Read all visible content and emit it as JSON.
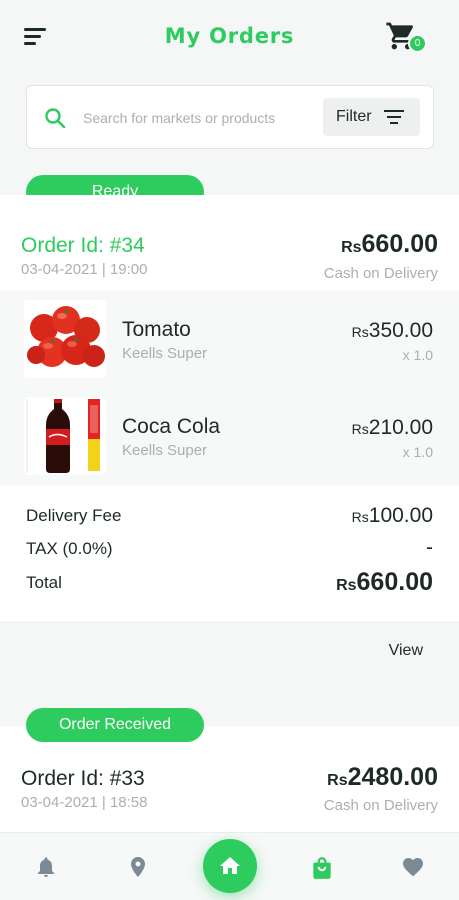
{
  "header": {
    "title": "My Orders",
    "cart_count": "0"
  },
  "search": {
    "placeholder": "Search for markets or products",
    "filter_label": "Filter"
  },
  "orders": [
    {
      "status": "Ready",
      "order_id": "Order Id: #34",
      "date": "03-04-2021 | 19:00",
      "currency": "Rs",
      "total": "660.00",
      "payment": "Cash on Delivery",
      "items": [
        {
          "name": "Tomato",
          "market": "Keells Super",
          "currency": "Rs",
          "price": "350.00",
          "qty": "x 1.0",
          "image": "tomato-image"
        },
        {
          "name": "Coca Cola",
          "market": "Keells Super",
          "currency": "Rs",
          "price": "210.00",
          "qty": "x 1.0",
          "image": "coca-cola-image"
        }
      ],
      "summary": {
        "delivery_label": "Delivery Fee",
        "delivery_currency": "Rs",
        "delivery_value": "100.00",
        "tax_label": "TAX (0.0%)",
        "tax_value": "-",
        "total_label": "Total",
        "total_currency": "Rs",
        "total_value": "660.00"
      },
      "view_label": "View"
    },
    {
      "status": "Order Received",
      "order_id": "Order Id: #33",
      "date": "03-04-2021 | 18:58",
      "currency": "Rs",
      "total": "2480.00",
      "payment": "Cash on Delivery"
    }
  ],
  "bottom_nav": {
    "icons": [
      "bell-icon",
      "location-pin-icon",
      "home-icon",
      "shopping-bag-icon",
      "heart-icon"
    ]
  },
  "colors": {
    "accent": "#2ecc5f",
    "text": "#1d2a26",
    "muted": "#a9b0ae",
    "nav_icon": "#7c8a96"
  }
}
